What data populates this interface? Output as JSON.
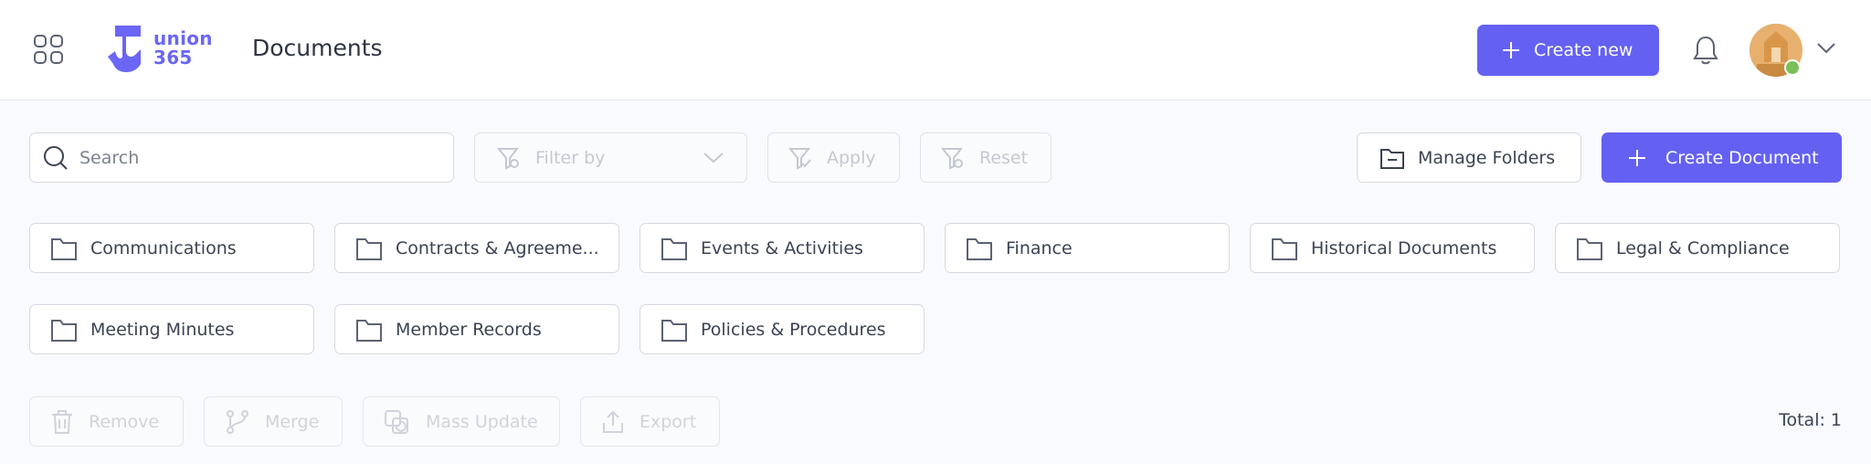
{
  "header": {
    "logo_text_line1": "union",
    "logo_text_line2": "365",
    "title": "Documents",
    "create_new_label": "Create new"
  },
  "toolbar": {
    "search_placeholder": "Search",
    "filter_label": "Filter by",
    "apply_label": "Apply",
    "reset_label": "Reset",
    "manage_folders_label": "Manage Folders",
    "create_document_label": "Create Document"
  },
  "folders": [
    {
      "label": "Communications"
    },
    {
      "label": "Contracts & Agreeme..."
    },
    {
      "label": "Events & Activities"
    },
    {
      "label": "Finance"
    },
    {
      "label": "Historical Documents"
    },
    {
      "label": "Legal & Compliance"
    },
    {
      "label": "Meeting Minutes"
    },
    {
      "label": "Member Records"
    },
    {
      "label": "Policies & Procedures"
    }
  ],
  "actions": {
    "remove_label": "Remove",
    "merge_label": "Merge",
    "mass_update_label": "Mass Update",
    "export_label": "Export"
  },
  "footer": {
    "total_text": "Total: 1"
  },
  "colors": {
    "accent": "#6461f2",
    "logo": "#6b66f5",
    "status_online": "#7bbf5a"
  },
  "icons": [
    "apps-grid-icon",
    "bell-icon",
    "chevron-down-icon",
    "search-icon",
    "filter-icon",
    "folder-icon",
    "plus-icon",
    "trash-icon",
    "merge-icon",
    "mass-update-icon",
    "export-icon"
  ]
}
